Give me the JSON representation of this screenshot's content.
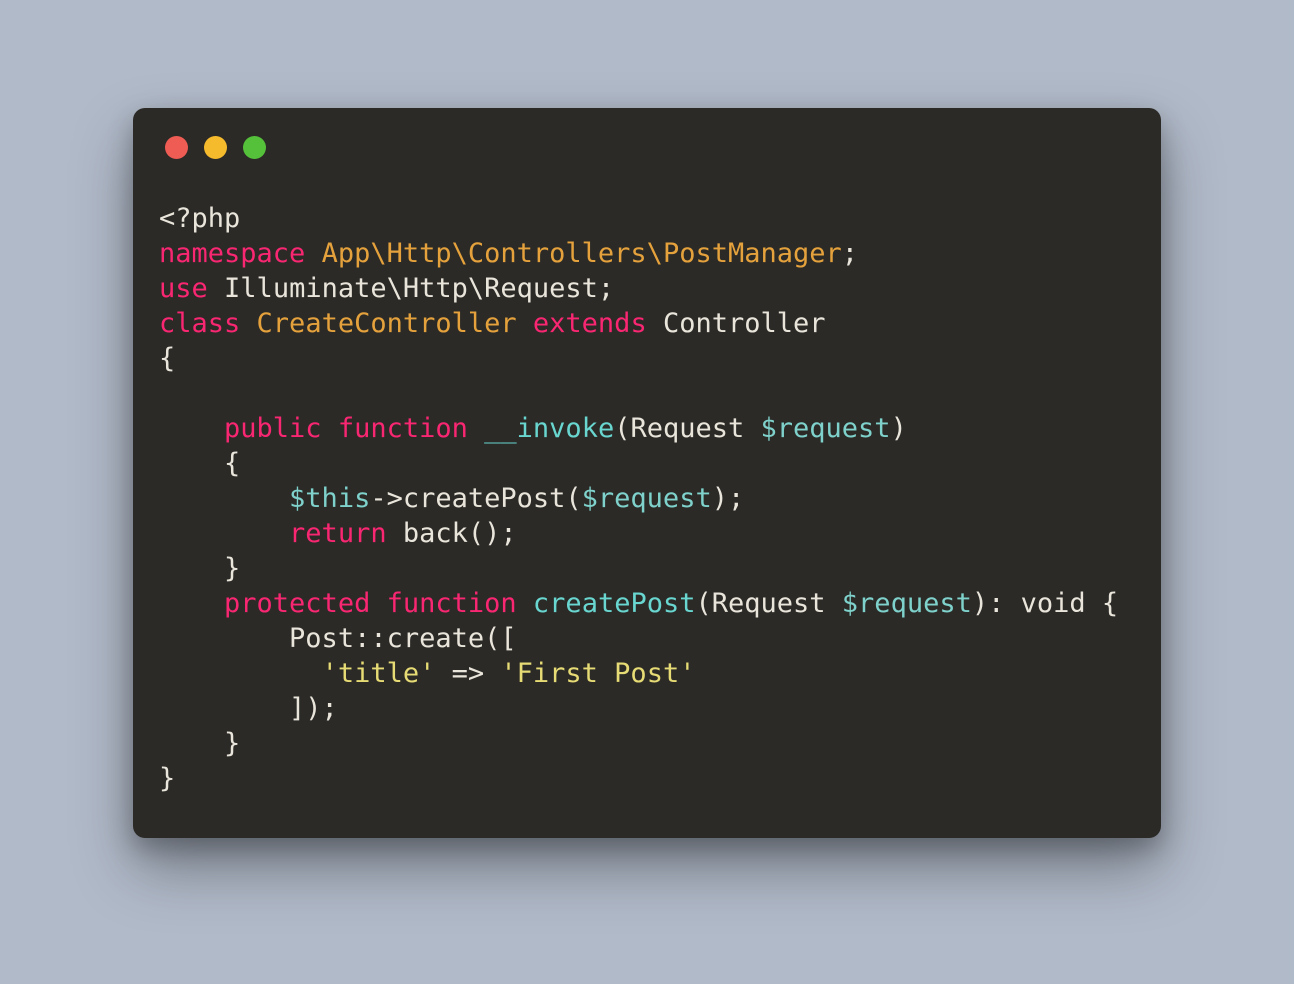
{
  "window": {
    "dots": {
      "red": "#ee5c54",
      "yellow": "#f6bb2d",
      "green": "#55c03a"
    }
  },
  "code": {
    "l1_open": "<?php",
    "l2_kw_namespace": "namespace",
    "l2_ns": "App\\Http\\Controllers\\PostManager",
    "l2_semi": ";",
    "l3_kw_use": "use",
    "l3_ns": "Illuminate\\Http\\Request",
    "l3_semi": ";",
    "l4_kw_class": "class",
    "l4_classname": "CreateController",
    "l4_kw_extends": "extends",
    "l4_parent": "Controller",
    "l5_brace_open_class": "{",
    "blank": "",
    "l7_kw_public": "public",
    "l7_kw_function": "function",
    "l7_fn_invoke": "__invoke",
    "l7_sig_open": "(Request ",
    "l7_var_request": "$request",
    "l7_sig_close": ")",
    "l8_brace_open_invoke": "{",
    "l9_var_this": "$this",
    "l9_arrow_call": "->createPost(",
    "l9_var_request": "$request",
    "l9_call_close": ");",
    "l10_kw_return": "return",
    "l10_back": " back();",
    "l11_brace_close_invoke": "}",
    "l12_kw_protected": "protected",
    "l12_kw_function": "function",
    "l12_fn_createpost": "createPost",
    "l12_sig_open": "(Request ",
    "l12_var_request": "$request",
    "l12_sig_close": "): void {",
    "l13_postcreate": "Post::create([",
    "l14_str_key": "'title'",
    "l14_arrow": " => ",
    "l14_str_val": "'First Post'",
    "l15_arr_close": "]);",
    "l16_brace_close_createpost": "}",
    "l17_brace_close_class": "}"
  }
}
